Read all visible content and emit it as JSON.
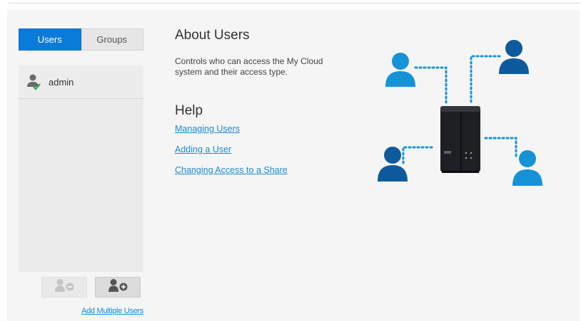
{
  "tabs": {
    "users": "Users",
    "groups": "Groups"
  },
  "users": [
    {
      "name": "admin"
    }
  ],
  "sidebar": {
    "remove_user_icon": "user-minus-icon",
    "add_user_icon": "user-plus-icon",
    "add_multiple_users": "Add Multiple Users"
  },
  "about": {
    "title": "About Users",
    "description": "Controls who can access the My Cloud system and their access type."
  },
  "help": {
    "title": "Help",
    "links": [
      "Managing Users",
      "Adding a User",
      "Changing Access to a Share"
    ]
  },
  "colors": {
    "accent": "#0a7bd9",
    "link": "#1a8ad6",
    "illustration_user": "#1693d6",
    "illustration_user_dark": "#0d5b9c"
  }
}
